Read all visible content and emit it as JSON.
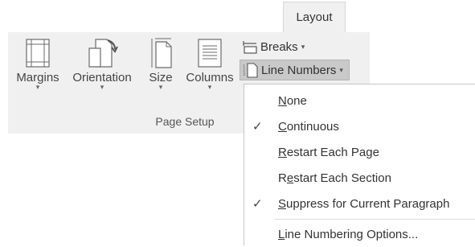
{
  "tab": {
    "label": "Layout"
  },
  "ribbon": {
    "group_label": "Page Setup",
    "buttons": {
      "margins": "Margins",
      "orientation": "Orientation",
      "size": "Size",
      "columns": "Columns"
    },
    "dropdown_arrow": "▾",
    "breaks": {
      "label": "Breaks",
      "icon": "breaks-icon"
    },
    "line_numbers": {
      "label": "Line Numbers",
      "icon": "line-numbers-icon",
      "state": "pressed"
    }
  },
  "menu": {
    "items": [
      {
        "label_parts": [
          "",
          "N",
          "one"
        ],
        "checked": false
      },
      {
        "label_parts": [
          "",
          "C",
          "ontinuous"
        ],
        "checked": true
      },
      {
        "label_parts": [
          "",
          "R",
          "estart Each Page"
        ],
        "checked": false
      },
      {
        "label_parts": [
          "R",
          "e",
          "start Each Section"
        ],
        "checked": false
      },
      {
        "label_parts": [
          "",
          "S",
          "uppress for Current Paragraph"
        ],
        "checked": true
      },
      {
        "label_parts": [
          "",
          "L",
          "ine Numbering Options..."
        ],
        "checked": false
      }
    ],
    "check_glyph": "✓"
  }
}
